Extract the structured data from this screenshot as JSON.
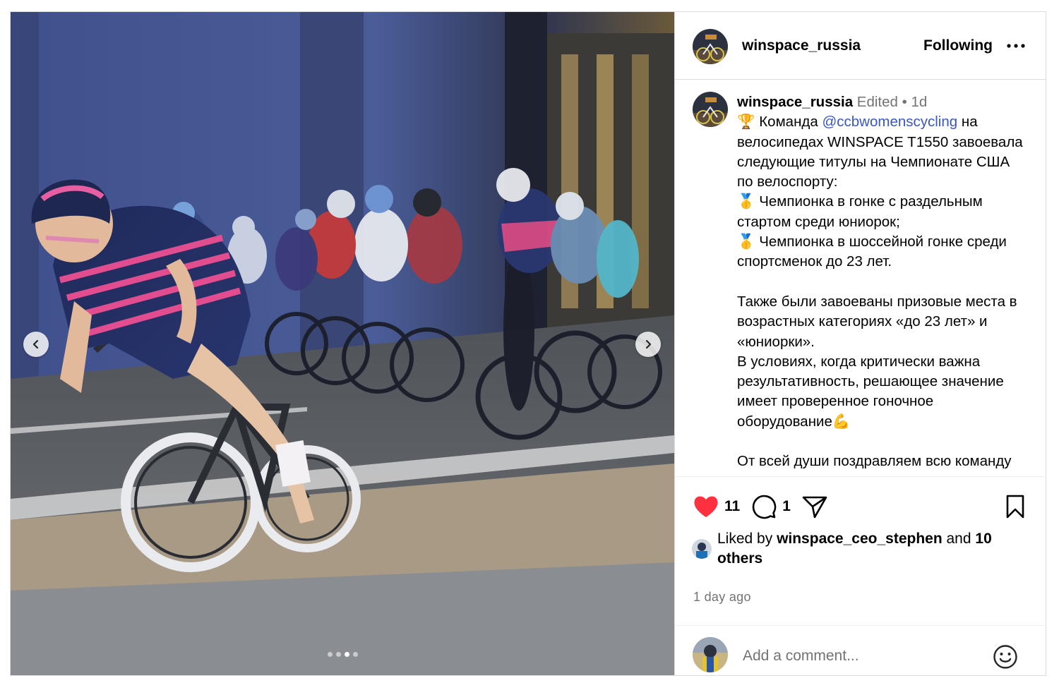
{
  "post": {
    "author": "winspace_russia",
    "follow_label": "Following",
    "more_icon": "more-horizontal-icon",
    "media": {
      "image_count": 4,
      "active_index": 3,
      "prev_icon": "chevron-left-icon",
      "next_icon": "chevron-right-icon"
    },
    "caption": {
      "username": "winspace_russia",
      "edited_label": "Edited",
      "separator": "•",
      "age": "1d",
      "line1_emoji": "🏆",
      "line1_prefix": " Команда ",
      "mention": "@ccbwomenscycling",
      "line1_suffix": " на велосипедах WINSPACE T1550 завоевала следующие титулы на Чемпионате США по велоспорту:",
      "title1": "🥇 Чемпионка в гонке с раздельным стартом среди юниорок;",
      "title2": "🥇 Чемпионка в шоссейной гонке среди спортсменок до 23 лет.",
      "para2": "Также были завоеваны призовые места в возрастных категориях «до 23 лет» и «юниорки».",
      "para3": "В условиях, когда критически важна результативность, решающее значение имеет проверенное гоночное оборудование💪",
      "para4": "От всей души поздравляем всю команду"
    },
    "likes_count": "11",
    "comments_count": "1",
    "liked_by_prefix": "Liked by ",
    "liked_by_user": "winspace_ceo_stephen",
    "liked_by_and": " and ",
    "liked_by_others": "10 others",
    "time_ago": "1 day ago",
    "comment_placeholder": "Add a comment...",
    "colors": {
      "like": "#ff3040",
      "mention": "#3a56c4",
      "muted": "#737373",
      "border": "#dbdbdb"
    }
  }
}
